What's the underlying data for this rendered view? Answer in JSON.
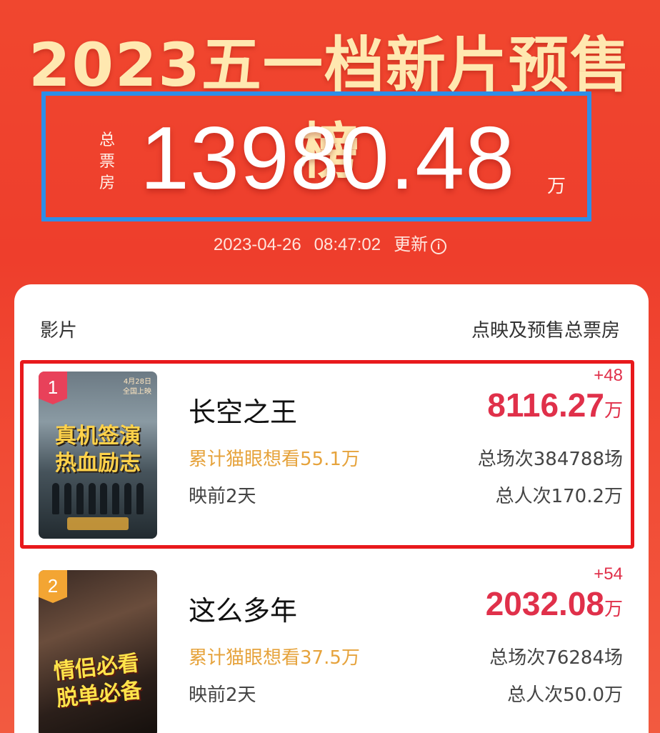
{
  "header": {
    "title": "2023五一档新片预售榜",
    "total_label": "总票房",
    "total_value": "13980.48",
    "total_unit": "万",
    "update_date": "2023-04-26",
    "update_time": "08:47:02",
    "update_label": "更新"
  },
  "table": {
    "col_left": "影片",
    "col_right": "点映及预售总票房"
  },
  "movies": [
    {
      "rank": "1",
      "name": "长空之王",
      "want": "累计猫眼想看55.1万",
      "pre_days": "映前2天",
      "delta": "+48",
      "gross": "8116.27",
      "gross_unit": "万",
      "shows": "总场次384788场",
      "people": "总人次170.2万",
      "poster_text_1": "真机签演",
      "poster_text_2": "热血励志",
      "poster_note_1": "4月28日",
      "poster_note_2": "全国上映"
    },
    {
      "rank": "2",
      "name": "这么多年",
      "want": "累计猫眼想看37.5万",
      "pre_days": "映前2天",
      "delta": "+54",
      "gross": "2032.08",
      "gross_unit": "万",
      "shows": "总场次76284场",
      "people": "总人次50.0万",
      "poster_text_1": "情侣必看",
      "poster_text_2": "脱单必备"
    }
  ],
  "colors": {
    "background": "#ee3e2c",
    "title": "#ffe8b0",
    "highlight_blue": "#2d8ee8",
    "highlight_red": "#e8191c",
    "gross": "#e0304a",
    "want": "#e6a33c"
  },
  "icons": {
    "info": "info-icon"
  }
}
